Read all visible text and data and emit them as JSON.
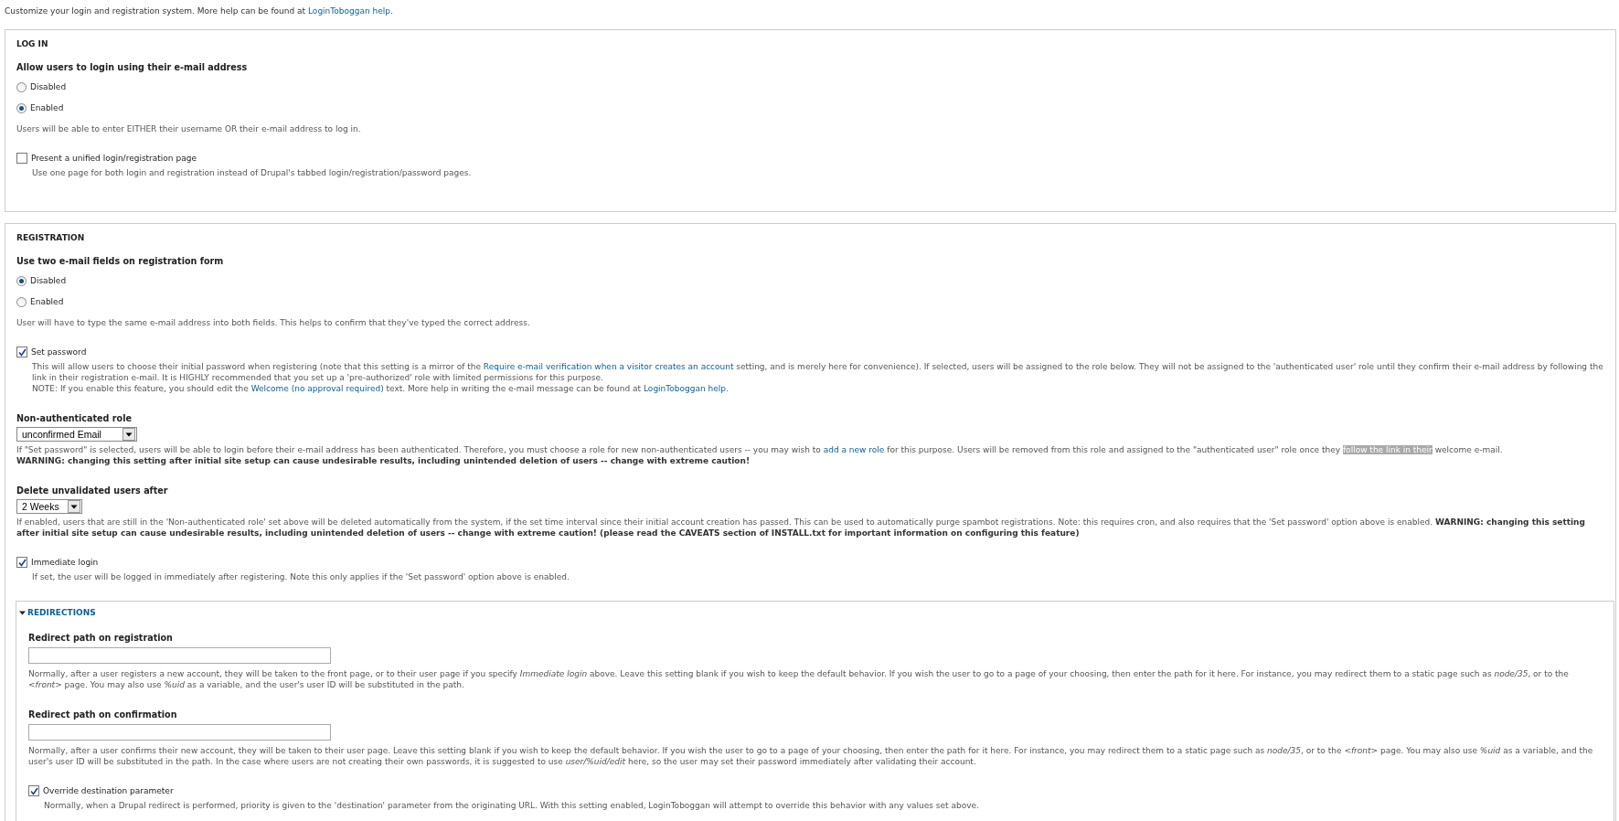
{
  "intro": [
    {
      "kind": "text",
      "text": "Customize your login and registration system. More help can be found at "
    },
    {
      "kind": "link",
      "text": "LoginToboggan help"
    },
    {
      "kind": "text",
      "text": "."
    }
  ],
  "sections": [
    {
      "legend": "LOG IN",
      "items": [
        {
          "kind": "radios",
          "title": "Allow users to login using their e-mail address",
          "options": [
            {
              "label": "Disabled",
              "selected": false
            },
            {
              "label": "Enabled",
              "selected": true
            }
          ],
          "description": [
            [
              {
                "kind": "text",
                "text": "Users will be able to enter EITHER their username OR their e-mail address to log in."
              }
            ]
          ]
        },
        {
          "kind": "checkbox",
          "label": "Present a unified login/registration page",
          "checked": false,
          "description": [
            [
              {
                "kind": "text",
                "text": "Use one page for both login and registration instead of Drupal's tabbed login/registration/password pages."
              }
            ]
          ]
        }
      ]
    },
    {
      "legend": "REGISTRATION",
      "items": [
        {
          "kind": "radios",
          "title": "Use two e-mail fields on registration form",
          "options": [
            {
              "label": "Disabled",
              "selected": true
            },
            {
              "label": "Enabled",
              "selected": false
            }
          ],
          "description": [
            [
              {
                "kind": "text",
                "text": "User will have to type the same e-mail address into both fields. This helps to confirm that they've typed the correct address."
              }
            ]
          ]
        },
        {
          "kind": "checkbox",
          "label": "Set password",
          "checked": true,
          "description": [
            [
              {
                "kind": "text",
                "text": "This will allow users to choose their initial password when registering (note that this setting is a mirror of the "
              },
              {
                "kind": "link",
                "text": "Require e-mail verification when a visitor creates an account"
              },
              {
                "kind": "text",
                "text": " setting, and is merely here for convenience). If selected, users will be assigned to the role below. They will not be assigned to the 'authenticated user' role until they confirm their e-mail address by following the link in their registration e-mail. It is HIGHLY recommended that you set up a 'pre-authorized' role with limited permissions for this purpose."
              }
            ],
            [
              {
                "kind": "text",
                "text": "NOTE: If you enable this feature, you should edit the "
              },
              {
                "kind": "link",
                "text": "Welcome (no approval required)"
              },
              {
                "kind": "text",
                "text": " text. More help in writing the e-mail message can be found at "
              },
              {
                "kind": "link",
                "text": "LoginToboggan help"
              },
              {
                "kind": "text",
                "text": "."
              }
            ]
          ]
        },
        {
          "kind": "select",
          "title": "Non-authenticated role",
          "value": "unconfirmed Email",
          "description": [
            [
              {
                "kind": "text",
                "text": "If \"Set password\" is selected, users will be able to login before their e-mail address has been authenticated. Therefore, you must choose a role for new non-authenticated users -- you may wish to "
              },
              {
                "kind": "link",
                "text": "add a new role"
              },
              {
                "kind": "text",
                "text": " for this purpose. Users will be removed from this role and assigned to the \"authenticated user\" role once they "
              },
              {
                "kind": "highlight",
                "text": "follow the link in their"
              },
              {
                "kind": "text",
                "text": " welcome e-mail."
              }
            ],
            [
              {
                "kind": "strong",
                "text": "WARNING: changing this setting after initial site setup can cause undesirable results, including unintended deletion of users -- change with extreme caution!"
              }
            ]
          ]
        },
        {
          "kind": "select",
          "title": "Delete unvalidated users after",
          "value": "2 Weeks",
          "description": [
            [
              {
                "kind": "text",
                "text": "If enabled, users that are still in the 'Non-authenticated role' set above will be deleted automatically from the system, if the set time interval since their initial account creation has passed. This can be used to automatically purge spambot registrations. Note: this requires cron, and also requires that the 'Set password' option above is enabled. "
              },
              {
                "kind": "strong",
                "text": "WARNING: changing this setting after initial site setup can cause undesirable results, including unintended deletion of users -- change with extreme caution! (please read the CAVEATS section of INSTALL.txt for important information on configuring this feature)"
              }
            ]
          ]
        },
        {
          "kind": "checkbox",
          "label": "Immediate login",
          "checked": true,
          "description": [
            [
              {
                "kind": "text",
                "text": "If set, the user will be logged in immediately after registering. Note this only applies if the 'Set password' option above is enabled."
              }
            ]
          ]
        },
        {
          "kind": "group",
          "legend": "REDIRECTIONS",
          "expanded": true,
          "items": [
            {
              "kind": "textfield",
              "title": "Redirect path on registration",
              "description": [
                [
                  {
                    "kind": "text",
                    "text": "Normally, after a user registers a new account, they will be taken to the front page, or to their user page if you specify "
                  },
                  {
                    "kind": "em",
                    "text": "Immediate login"
                  },
                  {
                    "kind": "text",
                    "text": " above. Leave this setting blank if you wish to keep the default behavior. If you wish the user to go to a page of your choosing, then enter the path for it here. For instance, you may redirect them to a static page such as "
                  },
                  {
                    "kind": "em",
                    "text": "node/35"
                  },
                  {
                    "kind": "text",
                    "text": ", or to the "
                  },
                  {
                    "kind": "em",
                    "text": "<front>"
                  },
                  {
                    "kind": "text",
                    "text": " page. You may also use "
                  },
                  {
                    "kind": "em",
                    "text": "%uid"
                  },
                  {
                    "kind": "text",
                    "text": " as a variable, and the user's user ID will be substituted in the path."
                  }
                ]
              ]
            },
            {
              "kind": "textfield",
              "title": "Redirect path on confirmation",
              "description": [
                [
                  {
                    "kind": "text",
                    "text": "Normally, after a user confirms their new account, they will be taken to their user page. Leave this setting blank if you wish to keep the default behavior. If you wish the user to go to a page of your choosing, then enter the path for it here. For instance, you may redirect them to a static page such as "
                  },
                  {
                    "kind": "em",
                    "text": "node/35"
                  },
                  {
                    "kind": "text",
                    "text": ", or to the "
                  },
                  {
                    "kind": "em",
                    "text": "<front>"
                  },
                  {
                    "kind": "text",
                    "text": " page. You may also use "
                  },
                  {
                    "kind": "em",
                    "text": "%uid"
                  },
                  {
                    "kind": "text",
                    "text": " as a variable, and the user's user ID will be substituted in the path. In the case where users are not creating their own passwords, it is suggested to use "
                  },
                  {
                    "kind": "em",
                    "text": "user/%uid/edit"
                  },
                  {
                    "kind": "text",
                    "text": " here, so the user may set their password immediately after validating their account."
                  }
                ]
              ]
            },
            {
              "kind": "checkbox",
              "label": "Override destination parameter",
              "checked": true,
              "description": [
                [
                  {
                    "kind": "text",
                    "text": "Normally, when a Drupal redirect is performed, priority is given to the 'destination' parameter from the originating URL. With this setting enabled, LoginToboggan will attempt to override this behavior with any values set above."
                  }
                ]
              ]
            }
          ]
        }
      ]
    }
  ]
}
